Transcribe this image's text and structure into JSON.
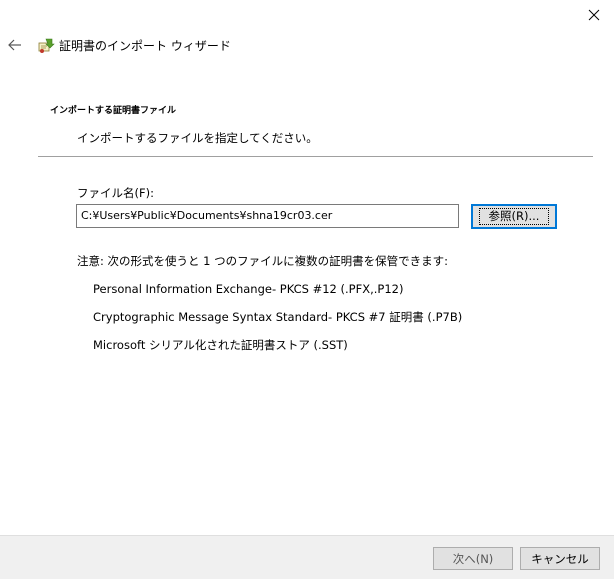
{
  "window": {
    "title": "証明書のインポート ウィザード"
  },
  "section": {
    "title": "インポートする証明書ファイル",
    "description": "インポートするファイルを指定してください。"
  },
  "file": {
    "label": "ファイル名(F):",
    "value": "C:¥Users¥Public¥Documents¥shna19cr03.cer",
    "browse_label": "参照(R)..."
  },
  "note": "注意: 次の形式を使うと 1 つのファイルに複数の証明書を保管できます:",
  "formats": [
    "Personal Information Exchange- PKCS #12 (.PFX,.P12)",
    "Cryptographic Message Syntax Standard- PKCS #7 証明書 (.P7B)",
    "Microsoft シリアル化された証明書ストア (.SST)"
  ],
  "footer": {
    "next_label": "次へ(N)",
    "cancel_label": "キャンセル"
  },
  "icons": {
    "close": "close-icon",
    "back": "back-arrow-icon",
    "app": "certificate-wizard-icon"
  }
}
